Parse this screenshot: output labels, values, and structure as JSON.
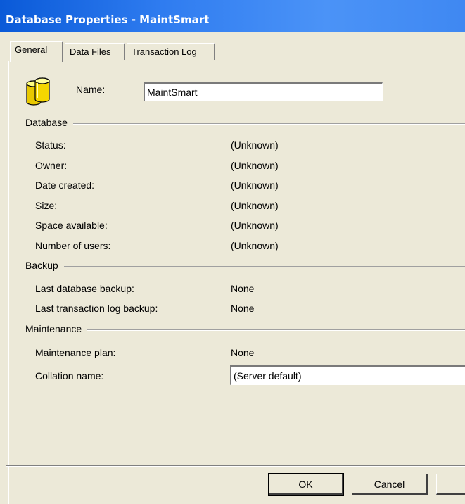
{
  "window": {
    "title": "Database Properties - MaintSmart"
  },
  "tabs": [
    {
      "label": "General",
      "active": true
    },
    {
      "label": "Data Files",
      "active": false
    },
    {
      "label": "Transaction Log",
      "active": false
    }
  ],
  "general": {
    "icon": "database-icon",
    "name_label": "Name:",
    "name_value": "MaintSmart"
  },
  "database": {
    "title": "Database",
    "rows": [
      {
        "label": "Status:",
        "value": "(Unknown)"
      },
      {
        "label": "Owner:",
        "value": "(Unknown)"
      },
      {
        "label": "Date created:",
        "value": "(Unknown)"
      },
      {
        "label": "Size:",
        "value": "(Unknown)"
      },
      {
        "label": "Space available:",
        "value": "(Unknown)"
      },
      {
        "label": "Number of users:",
        "value": "(Unknown)"
      }
    ]
  },
  "backup": {
    "title": "Backup",
    "rows": [
      {
        "label": "Last database backup:",
        "value": "None"
      },
      {
        "label": "Last transaction log backup:",
        "value": "None"
      }
    ]
  },
  "maintenance": {
    "title": "Maintenance",
    "plan_label": "Maintenance plan:",
    "plan_value": "None",
    "collation_label": "Collation name:",
    "collation_value": "(Server default)"
  },
  "buttons": {
    "ok": "OK",
    "cancel": "Cancel"
  },
  "colors": {
    "title_bar": "#2f7cf0",
    "dialog_bg": "#ece9d8"
  }
}
